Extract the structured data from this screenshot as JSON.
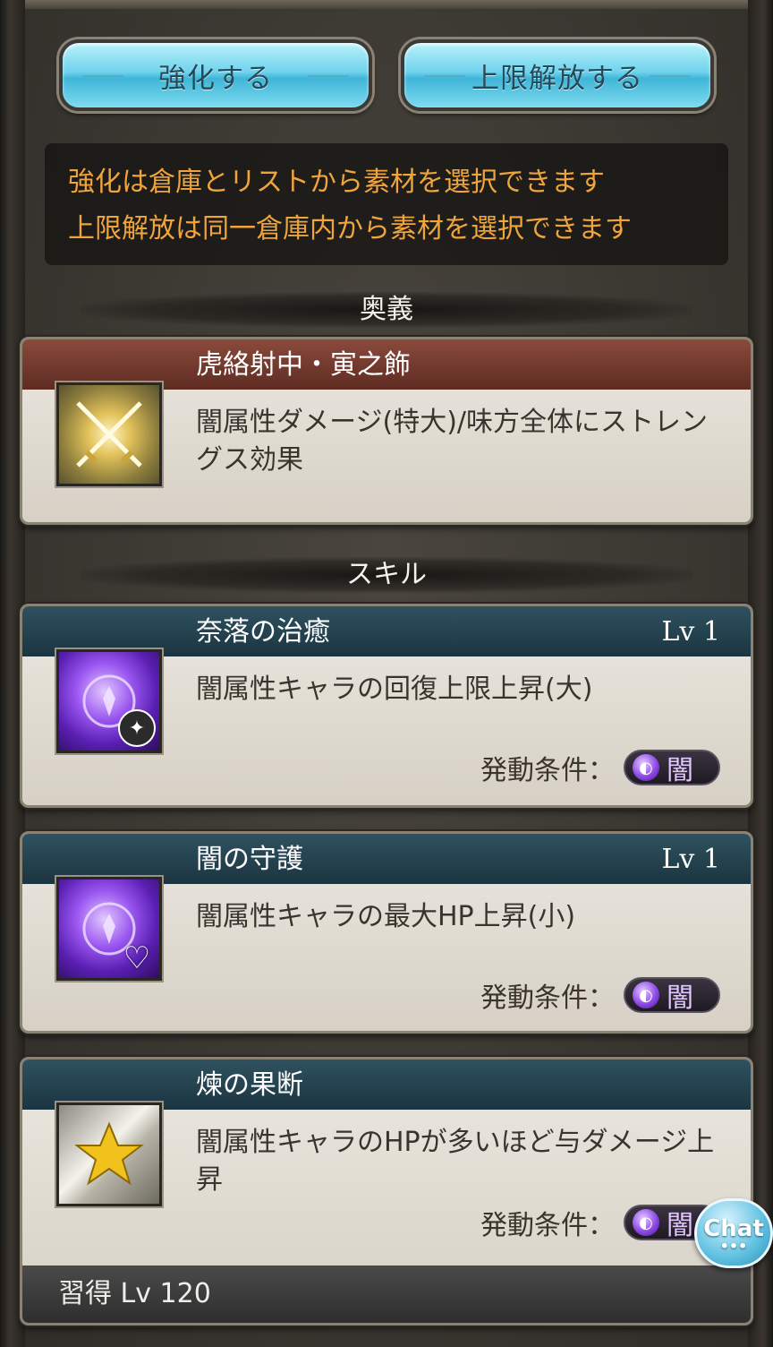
{
  "buttons": {
    "enhance": "強化する",
    "limit_break": "上限解放する"
  },
  "info": {
    "line1": "強化は倉庫とリストから素材を選択できます",
    "line2": "上限解放は同一倉庫内から素材を選択できます"
  },
  "sections": {
    "ougi": "奥義",
    "skill": "スキル"
  },
  "ougi": {
    "name": "虎絡射中・寅之飾",
    "description": "闇属性ダメージ(特大)/味方全体にストレングス効果",
    "icon": "crossed-swords-icon"
  },
  "skills": [
    {
      "name": "奈落の治癒",
      "level": "Lv 1",
      "description": "闇属性キャラの回復上限上昇(大)",
      "condition_label": "発動条件：",
      "condition_value": "闇",
      "icon": "dark-heal-cap-icon"
    },
    {
      "name": "闇の守護",
      "level": "Lv 1",
      "description": "闇属性キャラの最大HP上昇(小)",
      "condition_label": "発動条件：",
      "condition_value": "闇",
      "icon": "dark-hp-up-icon"
    },
    {
      "name": "煉の果断",
      "level": "",
      "description": "闇属性キャラのHPが多いほど与ダメージ上昇",
      "condition_label": "発動条件：",
      "condition_value": "闇",
      "icon": "star-icon",
      "acquire": "習得 Lv 120"
    }
  ],
  "chat": {
    "label": "Chat",
    "dots": "•••"
  },
  "colors": {
    "info_text": "#f0a43c",
    "ougi_header": "#8a4a3c",
    "skill_header": "#2f5160",
    "button_blue": "#6fd3ec"
  }
}
